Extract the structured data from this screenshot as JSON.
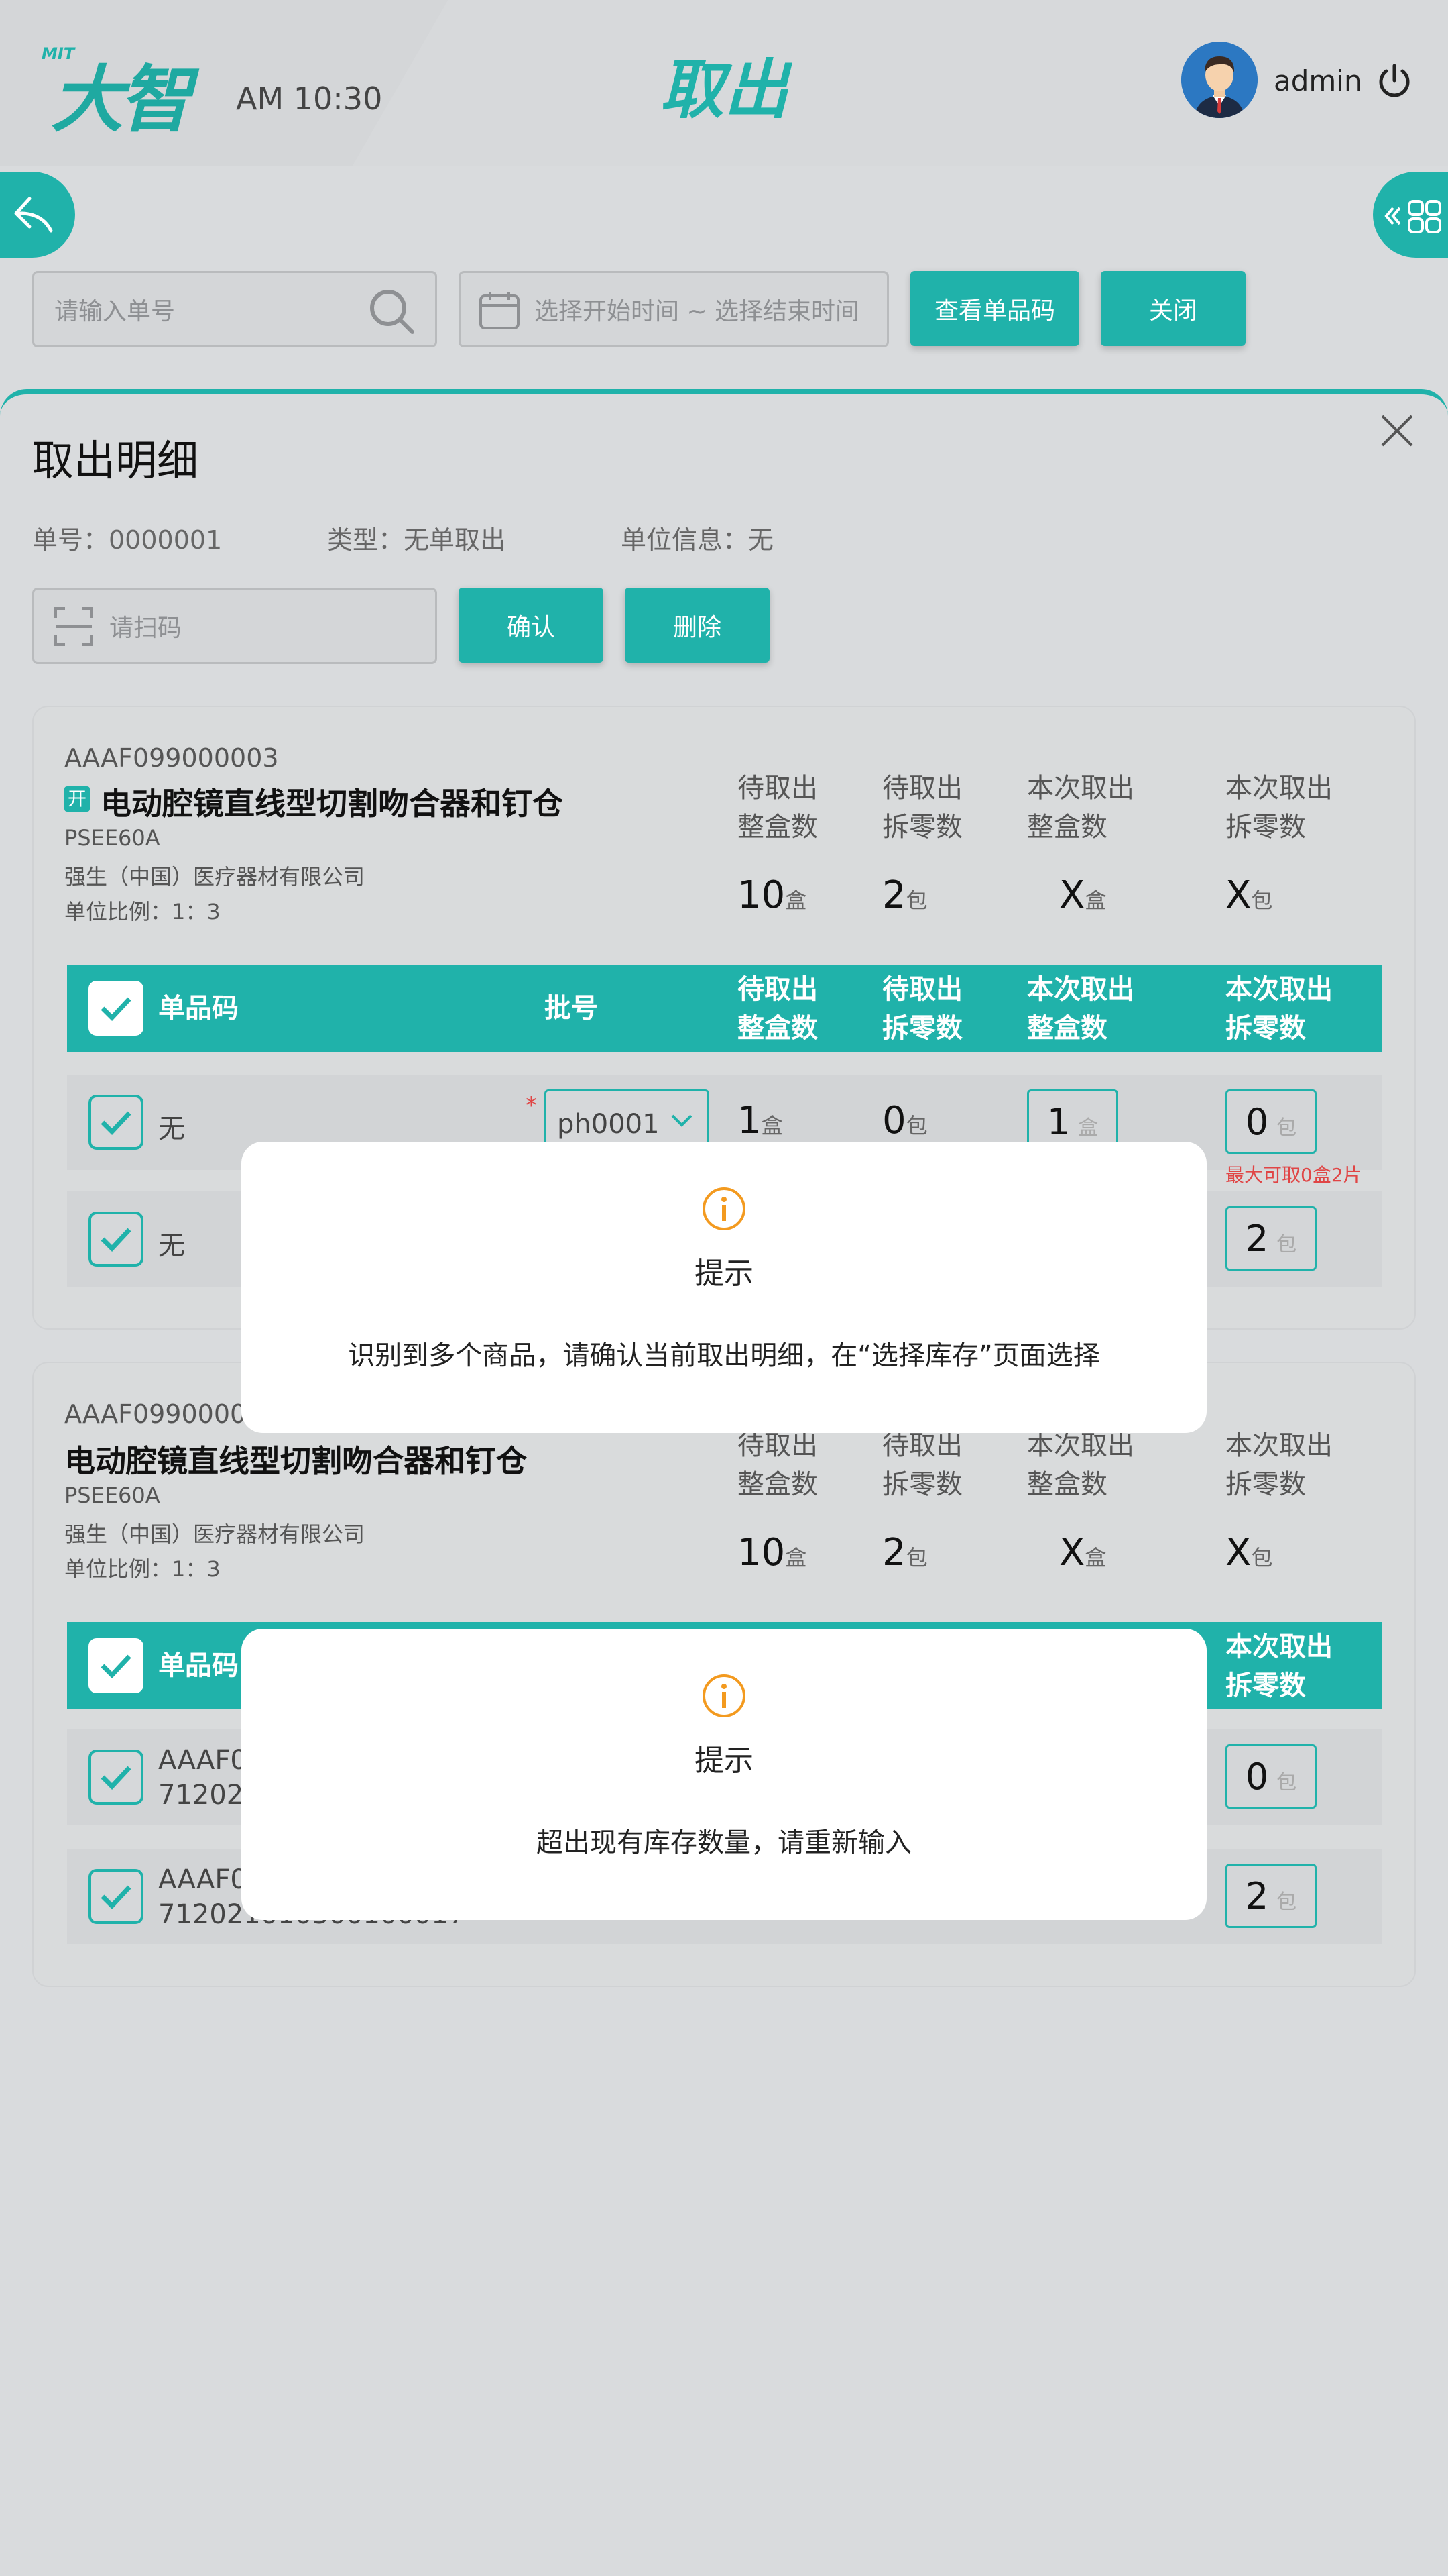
{
  "header": {
    "logo_small": "MIT",
    "logo_main": "大智",
    "time": "AM 10:30",
    "title": "取出",
    "user": "admin"
  },
  "toolbar": {
    "order_placeholder": "请输入单号",
    "date_placeholder": "选择开始时间 ~ 选择结束时间",
    "view_barcode_label": "查看单品码",
    "close_label": "关闭"
  },
  "panel": {
    "title": "取出明细",
    "order_no": "单号：0000001",
    "type": "类型：无单取出",
    "unit_info": "单位信息：无",
    "scan_placeholder": "请扫码",
    "confirm_label": "确认",
    "delete_label": "删除"
  },
  "card1": {
    "code": "AAAF099000003",
    "tag": "开",
    "name": "电动腔镜直线型切割吻合器和钉仓",
    "model": "PSEE60A",
    "company": "强生（中国）医疗器材有限公司",
    "ratio": "单位比例：1：3",
    "col1a": "待取出",
    "col1b": "整盒数",
    "col2a": "待取出",
    "col2b": "拆零数",
    "col3a": "本次取出",
    "col3b": "整盒数",
    "col4a": "本次取出",
    "col4b": "拆零数",
    "v1": "10",
    "u1": "盒",
    "v2": "2",
    "u2": "包",
    "v3": "X",
    "u3": "盒",
    "v4": "X",
    "u4": "包",
    "th_barcode": "单品码",
    "th_batch": "批号",
    "rows": [
      {
        "barcode": "无",
        "batch": "ph0001",
        "v1": "1",
        "u1": "盒",
        "v2": "0",
        "u2": "包",
        "in1": "1",
        "iu1": "盒",
        "in2": "0",
        "iu2": "包",
        "hint": "最大可取0盒2片"
      },
      {
        "barcode": "无",
        "in2": "2",
        "iu2": "包"
      }
    ]
  },
  "card2": {
    "code": "AAAF09900000",
    "name": "电动腔镜直线型切割吻合器和钉仓",
    "model": "PSEE60A",
    "company": "强生（中国）医疗器材有限公司",
    "ratio": "单位比例：1：3",
    "v1": "10",
    "u1": "盒",
    "v2": "2",
    "u2": "包",
    "v3": "X",
    "u3": "盒",
    "v4": "X",
    "u4": "包",
    "th_barcode": "单品码",
    "rows": [
      {
        "barcode_a": "AAAF09",
        "barcode_b": "712021",
        "in2": "0",
        "iu2": "包"
      },
      {
        "barcode_a": "AAAF09",
        "barcode_b": "712021010300100017",
        "in2": "2",
        "iu2": "包"
      }
    ]
  },
  "modal1": {
    "title": "提示",
    "message": "识别到多个商品，请确认当前取出明细，在“选择库存”页面选择"
  },
  "modal2": {
    "title": "提示",
    "message": "超出现有库存数量，请重新输入"
  },
  "colors": {
    "accent": "#20b2aa",
    "warning": "#f39a1f",
    "error": "#e04545"
  }
}
